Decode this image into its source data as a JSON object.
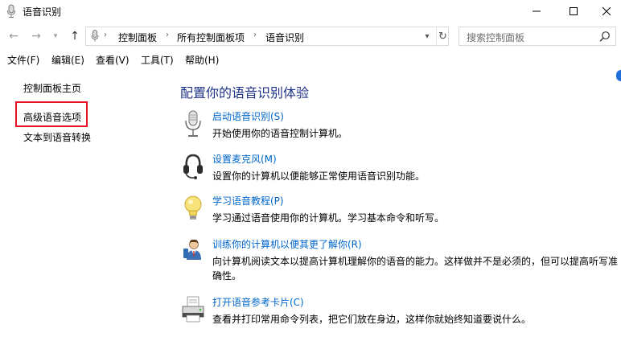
{
  "window": {
    "title": "语音识别"
  },
  "navigation": {
    "breadcrumb": [
      "控制面板",
      "所有控制面板项",
      "语音识别"
    ],
    "search_placeholder": "搜索控制面板"
  },
  "menu": {
    "items": [
      "文件(F)",
      "编辑(E)",
      "查看(V)",
      "工具(T)",
      "帮助(H)"
    ]
  },
  "sidebar": {
    "items": [
      {
        "label": "控制面板主页"
      },
      {
        "label": "高级语音选项"
      },
      {
        "label": "文本到语音转换"
      }
    ]
  },
  "main": {
    "heading": "配置你的语音识别体验",
    "tasks": [
      {
        "icon": "microphone-icon",
        "link": "启动语音识别(S)",
        "description": "开始使用你的语音控制计算机。"
      },
      {
        "icon": "headset-icon",
        "link": "设置麦克风(M)",
        "description": "设置你的计算机以便能够正常使用语音识别功能。"
      },
      {
        "icon": "lightbulb-icon",
        "link": "学习语音教程(P)",
        "description": "学习通过语音使用你的计算机。学习基本命令和听写。"
      },
      {
        "icon": "user-training-icon",
        "link": "训练你的计算机以便其更了解你(R)",
        "description": "向计算机阅读文本以提高计算机理解你的语音的能力。这样做并不是必须的，但可以提高听写准确性。"
      },
      {
        "icon": "printer-icon",
        "link": "打开语音参考卡片(C)",
        "description": "查看并打印常用命令列表，把它们放在身边，这样你就始终知道要说什么。"
      }
    ]
  },
  "colors": {
    "link": "#0066cc",
    "heading": "#1e3287",
    "highlight_border": "#e81123"
  }
}
